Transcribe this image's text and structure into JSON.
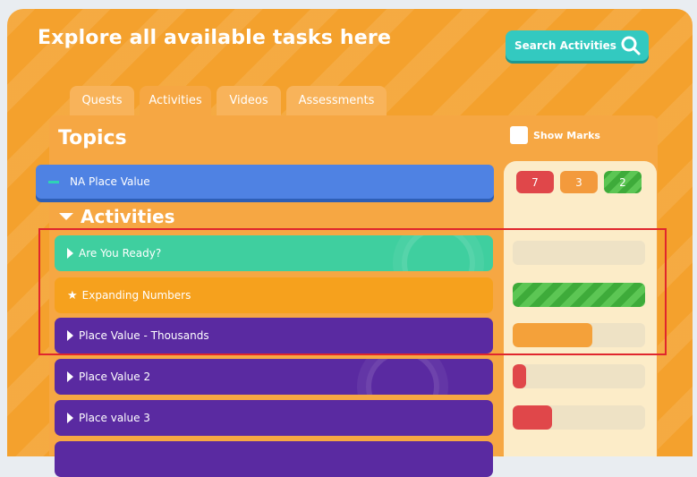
{
  "header": {
    "title": "Explore all available tasks here",
    "search_label": "Search Activities"
  },
  "tabs": [
    {
      "label": "Quests",
      "active": false
    },
    {
      "label": "Activities",
      "active": true
    },
    {
      "label": "Videos",
      "active": false
    },
    {
      "label": "Assessments",
      "active": false
    }
  ],
  "topics": {
    "heading": "Topics",
    "show_marks_label": "Show Marks",
    "show_marks_checked": false
  },
  "mark_badges": [
    {
      "value": "7",
      "color": "#e0474a"
    },
    {
      "value": "3",
      "color": "#f39a3c"
    },
    {
      "value": "2",
      "color": "#47b847"
    }
  ],
  "topic": {
    "label": "NA Place Value"
  },
  "activities_heading": "Activities",
  "activities": [
    {
      "label": "Are You Ready?",
      "color": "#3fcf9f",
      "icon": "play-triangle-icon",
      "progress": 0
    },
    {
      "label": "Expanding Numbers",
      "color": "#f6a11d",
      "icon": "star-icon",
      "progress": 1.0
    },
    {
      "label": "Place Value - Thousands",
      "color": "#5a2aa1",
      "icon": "play-triangle-icon",
      "progress": 0.6
    },
    {
      "label": "Place Value 2",
      "color": "#5a2aa1",
      "icon": "play-triangle-icon",
      "progress": 0.1
    },
    {
      "label": "Place value 3",
      "color": "#5a2aa1",
      "icon": "play-triangle-icon",
      "progress": 0.3
    }
  ]
}
